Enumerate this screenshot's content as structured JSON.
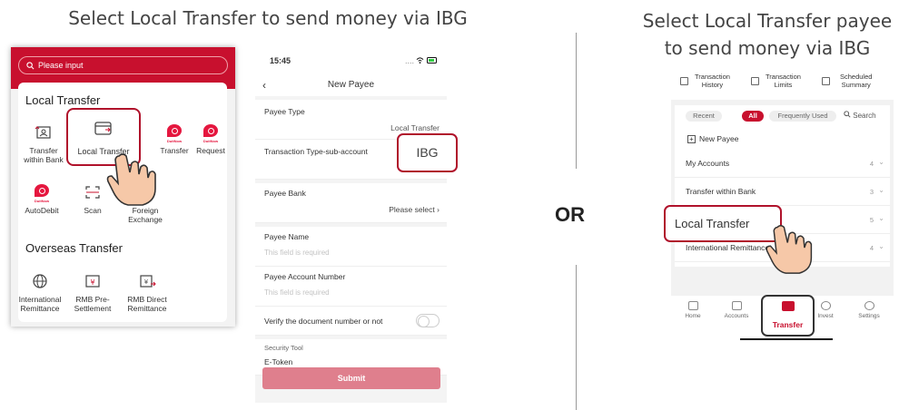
{
  "left_caption": "Select Local Transfer to send money via IBG",
  "right_caption_line1": "Select Local Transfer payee",
  "right_caption_line2": "to send money via IBG",
  "or_label": "OR",
  "screen1": {
    "search_placeholder": "Please input",
    "local_section": "Local Transfer",
    "local_tiles": [
      {
        "label1": "Transfer",
        "label2": "within Bank",
        "icon": "transfer-user-icon"
      },
      {
        "label1": "Local Transfer",
        "label2": "",
        "icon": "card-icon"
      },
      {
        "label1": "Transfer",
        "label2": "",
        "icon": "duitnow-icon"
      },
      {
        "label1": "Request",
        "label2": "",
        "icon": "duitnow-icon"
      },
      {
        "label1": "AutoDebit",
        "label2": "",
        "icon": "duitnow-icon"
      },
      {
        "label1": "Scan",
        "label2": "",
        "icon": "scan-icon"
      },
      {
        "label1": "Foreign",
        "label2": "Exchange",
        "icon": ""
      }
    ],
    "duitnow_text": "DuitNow",
    "overseas_section": "Overseas Transfer",
    "overseas_tiles": [
      {
        "label1": "International",
        "label2": "Remittance",
        "icon": "globe-icon"
      },
      {
        "label1": "RMB Pre-",
        "label2": "Settlement",
        "icon": "yuan-doc-icon"
      },
      {
        "label1": "RMB Direct",
        "label2": "Remittance",
        "icon": "yuan-transfer-icon"
      }
    ]
  },
  "screen2": {
    "time": "15:45",
    "status_icons": "....",
    "title": "New Payee",
    "payee_type_label": "Payee Type",
    "payee_type_value": "Local Transfer",
    "txn_type_label": "Transaction Type-sub-account",
    "txn_type_value": "IBG",
    "payee_bank_label": "Payee Bank",
    "payee_bank_value": "Please select",
    "payee_name_label": "Payee Name",
    "payee_name_placeholder": "This field is required",
    "payee_account_label": "Payee Account Number",
    "payee_account_placeholder": "This field is required",
    "verify_label": "Verify the document number or not",
    "verify_on": false,
    "security_tool_label": "Security Tool",
    "security_tool_value": "E-Token",
    "submit_label": "Submit"
  },
  "screen3": {
    "quick": [
      {
        "line1": "Transaction",
        "line2": "History"
      },
      {
        "line1": "Transaction",
        "line2": "Limits"
      },
      {
        "line1": "Scheduled",
        "line2": "Summary"
      }
    ],
    "filters": [
      "Recent",
      "All",
      "Frequently Used"
    ],
    "active_filter": "All",
    "search_label": "Search",
    "new_payee": "New Payee",
    "rows": [
      {
        "label": "My Accounts",
        "count": "4"
      },
      {
        "label": "Transfer within Bank",
        "count": "3"
      },
      {
        "label": "Local Transfer",
        "count": "5"
      },
      {
        "label": "International Remittance",
        "count": "4"
      }
    ],
    "tabs": [
      "Home",
      "Accounts",
      "Transfer",
      "Invest",
      "Settings"
    ],
    "accent": "#c8102e"
  }
}
